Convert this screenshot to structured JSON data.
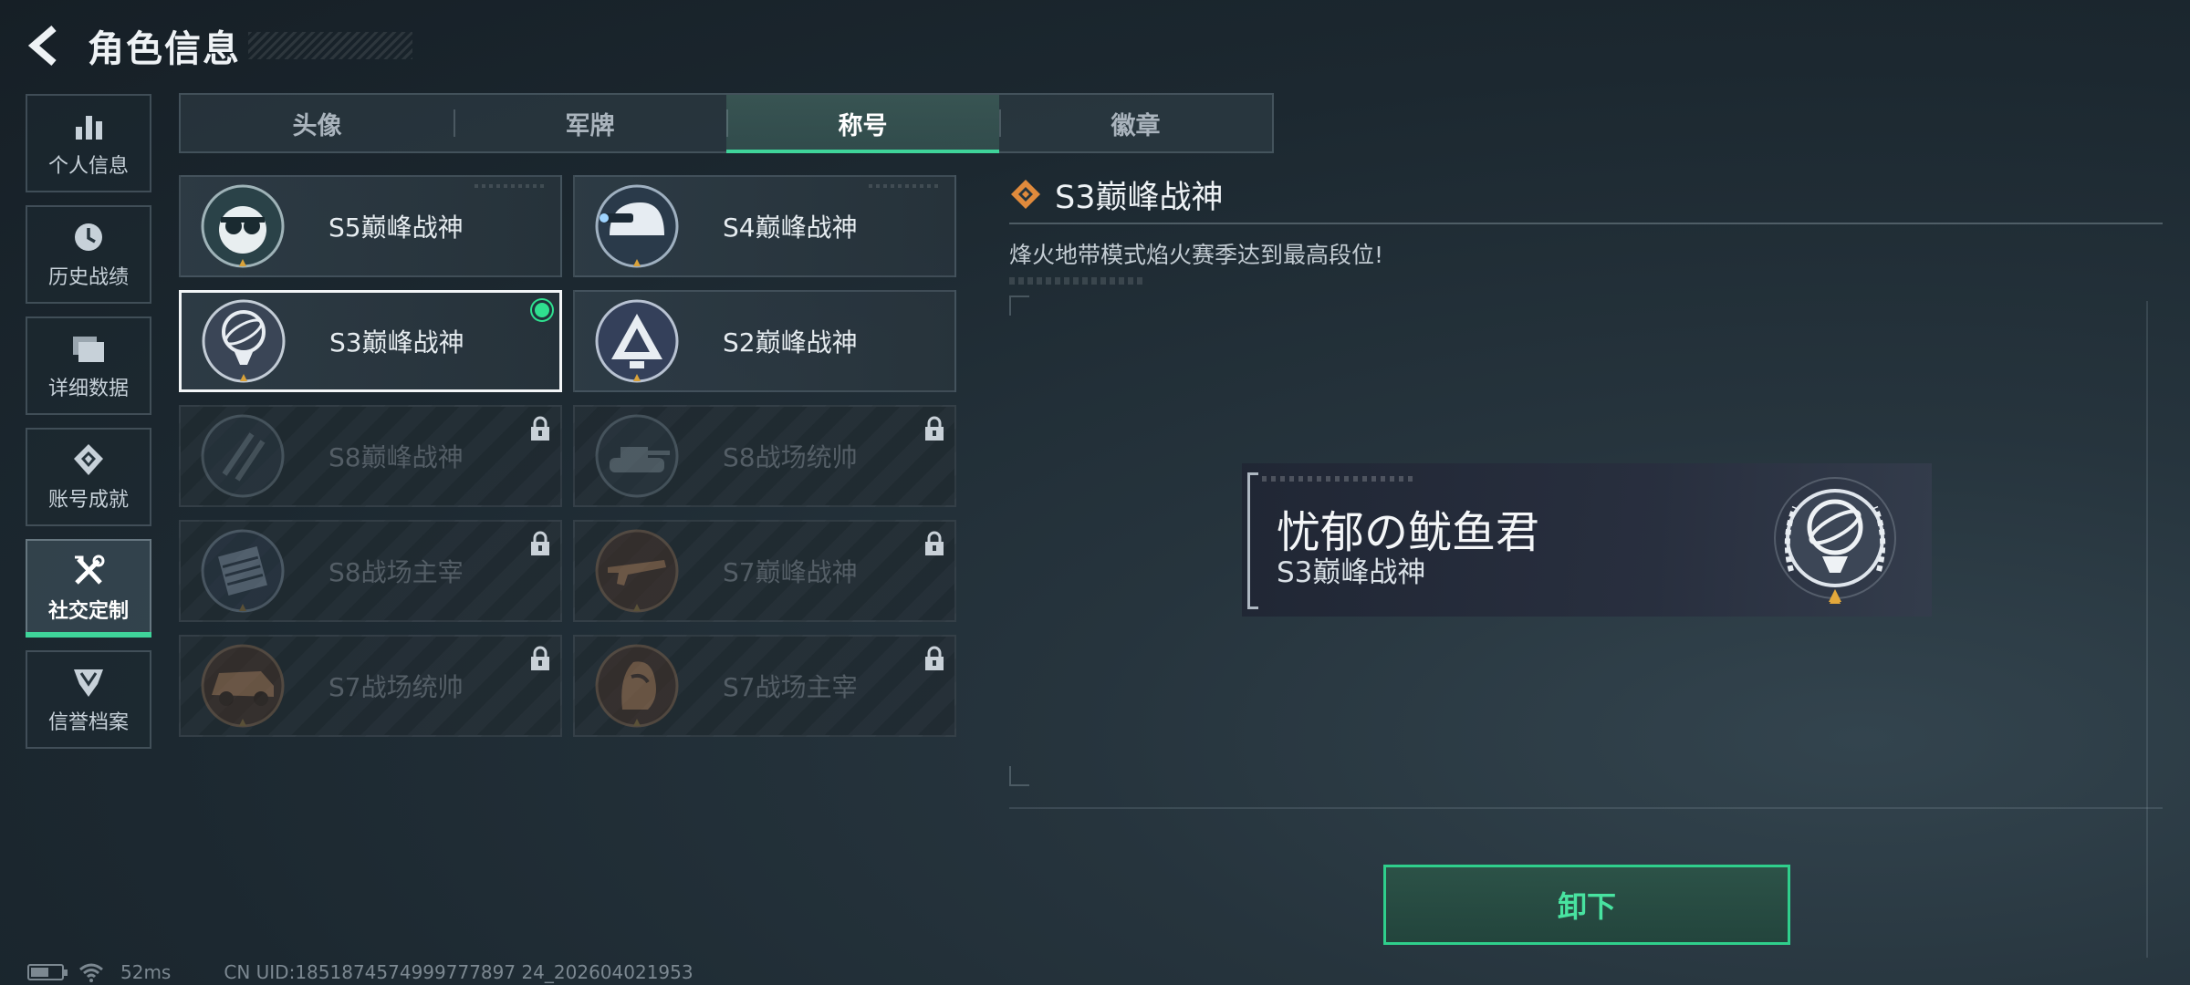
{
  "header": {
    "title": "角色信息"
  },
  "sidebar": {
    "items": [
      {
        "label": "个人信息",
        "icon": "bar-chart-icon",
        "active": false
      },
      {
        "label": "历史战绩",
        "icon": "clock-icon",
        "active": false
      },
      {
        "label": "详细数据",
        "icon": "folder-icon",
        "active": false
      },
      {
        "label": "账号成就",
        "icon": "achievement-icon",
        "active": false
      },
      {
        "label": "社交定制",
        "icon": "tools-icon",
        "active": true
      },
      {
        "label": "信誉档案",
        "icon": "shield-emblem-icon",
        "active": false
      }
    ]
  },
  "tabs": [
    {
      "label": "头像",
      "active": false
    },
    {
      "label": "军牌",
      "active": false
    },
    {
      "label": "称号",
      "active": true
    },
    {
      "label": "徽章",
      "active": false
    }
  ],
  "titles": [
    {
      "name": "S5巅峰战神",
      "emblem": "skull-goggles-emblem-icon",
      "locked": false,
      "selected": false,
      "equipped": false
    },
    {
      "name": "S4巅峰战神",
      "emblem": "helmet-emblem-icon",
      "locked": false,
      "selected": false,
      "equipped": false
    },
    {
      "name": "S3巅峰战神",
      "emblem": "armillary-emblem-icon",
      "locked": false,
      "selected": true,
      "equipped": true
    },
    {
      "name": "S2巅峰战神",
      "emblem": "triangle-eye-emblem-icon",
      "locked": false,
      "selected": false,
      "equipped": false
    },
    {
      "name": "S8巅峰战神",
      "emblem": "slash-emblem-icon",
      "locked": true,
      "selected": false,
      "equipped": false
    },
    {
      "name": "S8战场统帅",
      "emblem": "tank-emblem-icon",
      "locked": true,
      "selected": false,
      "equipped": false
    },
    {
      "name": "S8战场主宰",
      "emblem": "tower-emblem-icon",
      "locked": true,
      "selected": false,
      "equipped": false
    },
    {
      "name": "S7巅峰战神",
      "emblem": "rifle-emblem-icon",
      "locked": true,
      "selected": false,
      "equipped": false
    },
    {
      "name": "S7战场统帅",
      "emblem": "vehicle-emblem-icon",
      "locked": true,
      "selected": false,
      "equipped": false
    },
    {
      "name": "S7战场主宰",
      "emblem": "soldier-emblem-icon",
      "locked": true,
      "selected": false,
      "equipped": false
    }
  ],
  "detail": {
    "title": "S3巅峰战神",
    "description": "烽火地带模式焰火赛季达到最高段位!"
  },
  "preview": {
    "player_name": "忧郁の鱿鱼君",
    "title": "S3巅峰战神"
  },
  "actions": {
    "unequip_label": "卸下"
  },
  "status_bar": {
    "battery_level": 0.6,
    "ping": "52ms",
    "uid": "CN UID:1851874574999777897 24_202604021953"
  },
  "colors": {
    "accent": "#3fd49a",
    "selected_border": "#f2f5f7",
    "diamond": "#e08a3c"
  }
}
